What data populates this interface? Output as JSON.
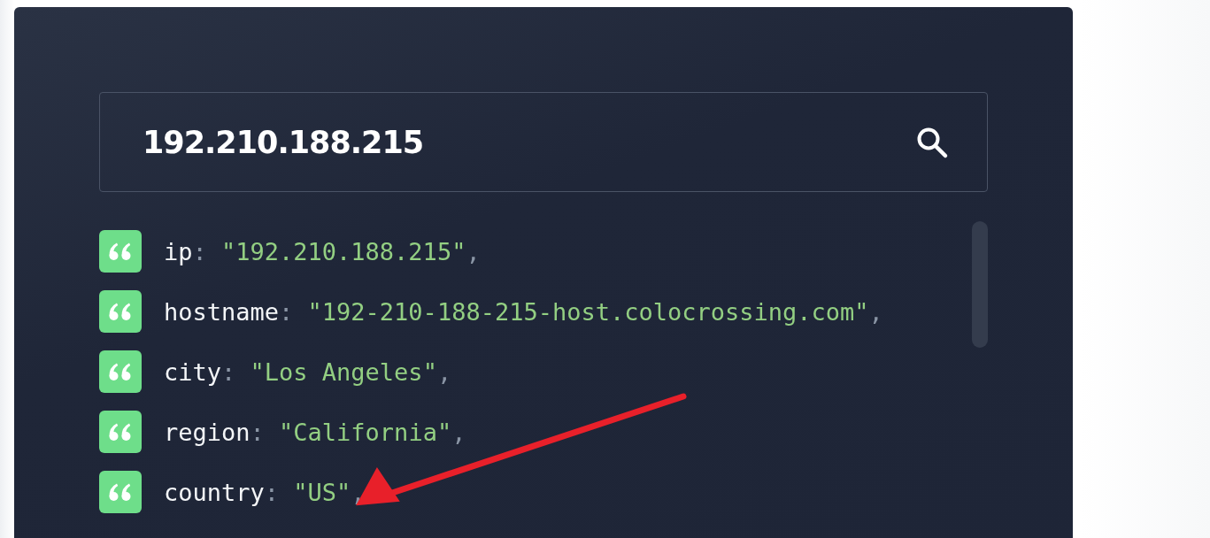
{
  "search": {
    "value": "192.210.188.215"
  },
  "rows": [
    {
      "key": "ip",
      "colon": ":",
      "value": "\"192.210.188.215\"",
      "suffix": ","
    },
    {
      "key": "hostname",
      "colon": ":",
      "value": "\"192-210-188-215-host.colocrossing.com\"",
      "suffix": ","
    },
    {
      "key": "city",
      "colon": ":",
      "value": "\"Los Angeles\"",
      "suffix": ","
    },
    {
      "key": "region",
      "colon": ":",
      "value": "\"California\"",
      "suffix": ","
    },
    {
      "key": "country",
      "colon": ":",
      "value": "\"US\"",
      "suffix": ","
    }
  ],
  "annotation": {
    "kind": "arrow"
  }
}
